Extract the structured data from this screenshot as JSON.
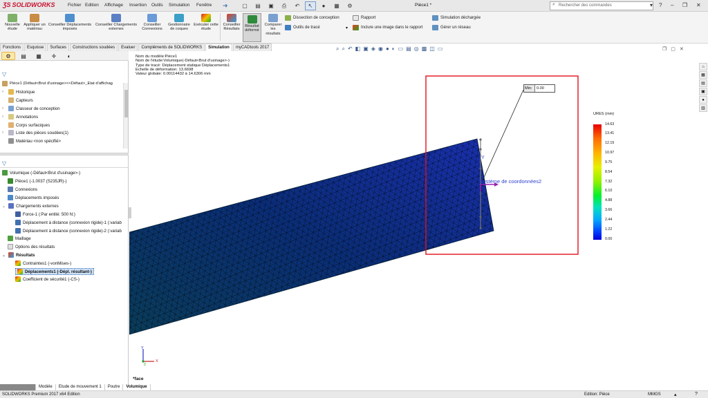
{
  "app": {
    "logo_text": "SOLIDWORKS",
    "menus": [
      "Fichier",
      "Edition",
      "Affichage",
      "Insertion",
      "Outils",
      "Simulation",
      "Fenêtre"
    ],
    "document_title": "Pièce1 *",
    "search_placeholder": "Rechercher des commandes",
    "help_label": "?"
  },
  "toolbar": {
    "buttons": [
      "Nouvelle étude",
      "Appliquer un matériau",
      "Conseiller Déplacements imposés",
      "Conseiller Chargements externes",
      "Conseiller Connexions",
      "Gestionnaire de coques",
      "Exécuter cette étude",
      "Conseiller Résultats",
      "Résultat déformé",
      "Comparer les résultats"
    ],
    "side_items": [
      "Dissection de conception",
      "Outils de tracé",
      "Rapport",
      "Inclure une image dans le rapport",
      "Simulation déchargée",
      "Gérer un réseau"
    ]
  },
  "tabs": [
    "Fonctions",
    "Esquisse",
    "Surfaces",
    "Constructions soudées",
    "Evaluer",
    "Compléments de SOLIDWORKS",
    "Simulation",
    "myCADtools 2017"
  ],
  "active_tab": "Simulation",
  "feature_tree": {
    "root": "Pièce1  (Défaut<Brut d'usinage><<Défaut>_Etat d'affichag",
    "items": [
      "Historique",
      "Capteurs",
      "Classeur de conception",
      "Annotations",
      "Corps surfaciques",
      "Liste des pièces soudées(1)",
      "Matériau <non spécifié>"
    ]
  },
  "study_tree": {
    "root": "Volumique (-Défaut<Brut d'usinage>-)",
    "part": "Pièce1 (-1.0037 (S235JR)-)",
    "connexions": "Connexions",
    "fixtures": "Déplacements imposés",
    "loads": "Chargements externes",
    "force": "Force-1 (:Par entité: 500 N:)",
    "remote1": "Déplacement à distance (connexion rigide)-1 (:variab",
    "remote2": "Déplacement à distance (connexion rigide)-2 (:variab",
    "mesh": "Maillage",
    "result_options": "Options des résultats",
    "results": "Résultats",
    "stress": "Contraintes1 (-vonMises-)",
    "displacement": "Déplacements1 (-Dépl. résultant-)",
    "fos": "Coefficient de sécurité1 (-CS-)"
  },
  "plot_info": [
    "Nom du modèle:Pièce1",
    "Nom de l'étude:Volumique(-Défaut<Brut d'usinage>-)",
    "Type de tracé: Déplacement statique Déplacements1",
    "Echelle de déformation: 13.6698",
    "Valeur globale: 0.00114432 à 14.6306 mm"
  ],
  "probe": {
    "label": "Min:",
    "value": "0.00"
  },
  "coord_label": "Système de coordonnées2",
  "legend": {
    "title": "URES (mm)",
    "ticks": [
      "14.63",
      "13.41",
      "12.19",
      "10.97",
      "9.75",
      "8.54",
      "7.32",
      "6.10",
      "4.88",
      "3.66",
      "2.44",
      "1.22",
      "0.00"
    ]
  },
  "triad": {
    "y": "Y",
    "x": "X",
    "z": "Z"
  },
  "view_label": "*face",
  "bottom_tabs": [
    "Modèle",
    "Etude de mouvement 1",
    "Poutre",
    "Volumique"
  ],
  "status": {
    "left": "SOLIDWORKS Premium 2017 x64 Edition",
    "edition": "Edition: Pièce",
    "units": "MMGS"
  },
  "colors": {
    "accent": "#c8102e",
    "mesh_dark": "#0a2e52",
    "mesh_light": "#1a3aa8",
    "highlight": "#e0101a"
  }
}
